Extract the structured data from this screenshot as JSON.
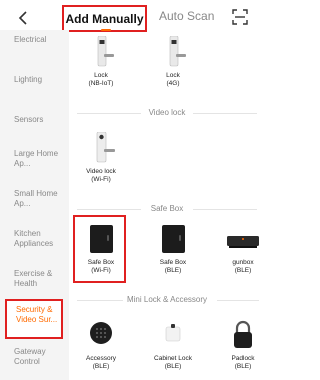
{
  "header": {
    "back_icon": "chevron-left-icon",
    "tabs": [
      {
        "label": "Add Manually",
        "active": true
      },
      {
        "label": "Auto Scan",
        "active": false
      }
    ],
    "scan_icon": "scan-icon",
    "accent_color": "#ff6a00",
    "highlight_color": "#e02020"
  },
  "sidebar": {
    "items": [
      {
        "label": "Electrical"
      },
      {
        "label": "Lighting"
      },
      {
        "label": "Sensors"
      },
      {
        "label": "Large Home Ap..."
      },
      {
        "label": "Small Home Ap..."
      },
      {
        "label": "Kitchen Appliances"
      },
      {
        "label": "Exercise & Health"
      },
      {
        "label": "Security & Video Sur...",
        "active": true
      },
      {
        "label": "Gateway Control"
      }
    ]
  },
  "main": {
    "top_devices": [
      {
        "name": "Lock",
        "sub": "(NB-IoT)",
        "icon": "smart-lock-icon"
      },
      {
        "name": "Lock",
        "sub": "(4G)",
        "icon": "smart-lock-icon"
      }
    ],
    "sections": [
      {
        "title": "Video lock",
        "devices": [
          {
            "name": "Video lock",
            "sub": "(Wi-Fi)",
            "icon": "video-lock-icon"
          }
        ]
      },
      {
        "title": "Safe Box",
        "devices": [
          {
            "name": "Safe Box",
            "sub": "(Wi-Fi)",
            "icon": "safe-box-icon"
          },
          {
            "name": "Safe Box",
            "sub": "(BLE)",
            "icon": "safe-box-icon"
          },
          {
            "name": "gunbox",
            "sub": "(BLE)",
            "icon": "gunbox-icon"
          }
        ]
      },
      {
        "title": "Mini Lock & Accessory",
        "devices": [
          {
            "name": "Accessory",
            "sub": "(BLE)",
            "icon": "keypad-icon"
          },
          {
            "name": "Cabinet Lock",
            "sub": "(BLE)",
            "icon": "cabinet-lock-icon"
          },
          {
            "name": "Padlock",
            "sub": "(BLE)",
            "icon": "padlock-icon"
          }
        ]
      }
    ]
  }
}
